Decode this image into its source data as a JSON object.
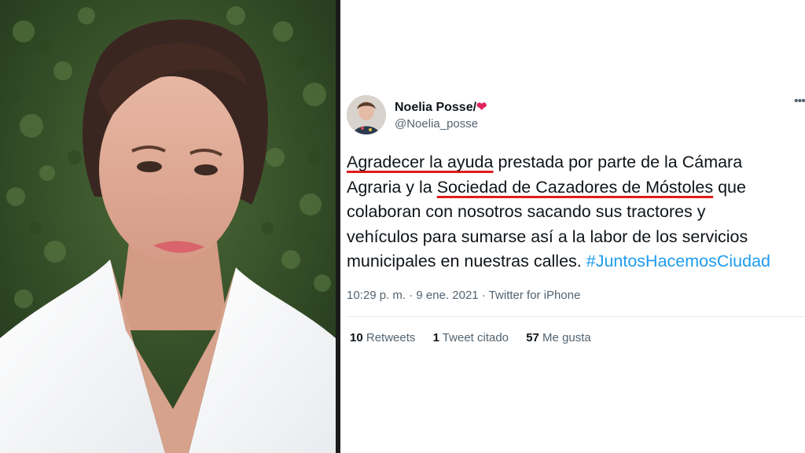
{
  "tweet": {
    "author_name": "Noelia Posse/",
    "author_emoji": "❤",
    "handle": "@Noelia_posse",
    "more_icon": "more-icon",
    "text": {
      "part1_underlined": "Agradecer la ayuda",
      "part2": " prestada por parte de la Cámara",
      "part3": "Agraria y la ",
      "part4_underlined": "Sociedad de Cazadores de Móstoles",
      "part5": " que",
      "part6": "colaboran con nosotros sacando sus tractores y",
      "part7": "vehículos para sumarse así a la labor de los servicios",
      "part8": "municipales en nuestras calles. ",
      "hashtag": "#JuntosHacemosCiudad"
    },
    "time": "10:29 p. m.",
    "dot": " · ",
    "date": "9 ene. 2021",
    "source": "Twitter for iPhone",
    "stats": {
      "retweets_count": "10",
      "retweets_label": " Retweets",
      "quotes_count": "1",
      "quotes_label": " Tweet citado",
      "likes_count": "57",
      "likes_label": " Me gusta"
    }
  },
  "colors": {
    "underline": "#e01b1b",
    "hashtag": "#1d9bf0",
    "heart": "#e0245e"
  }
}
